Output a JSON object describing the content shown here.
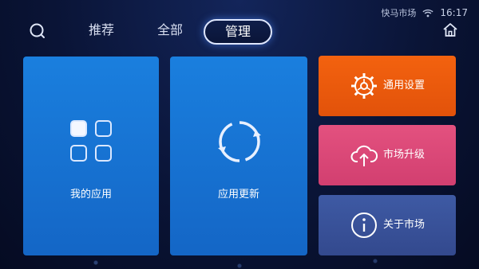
{
  "status_bar": {
    "app_name": "快马市场",
    "time": "16:17",
    "wifi_icon": "wifi-icon"
  },
  "top_nav": {
    "search_icon": "search-icon",
    "home_icon": "home-icon",
    "tabs": [
      {
        "label": "推荐",
        "selected": false
      },
      {
        "label": "全部",
        "selected": false
      },
      {
        "label": "管理",
        "selected": true
      }
    ]
  },
  "tiles": {
    "my_apps": {
      "label": "我的应用",
      "icon": "app-grid-icon",
      "color": "#1772d4"
    },
    "app_update": {
      "label": "应用更新",
      "icon": "refresh-icon",
      "color": "#1772d4"
    },
    "general_settings": {
      "label": "通用设置",
      "icon": "gear-icon",
      "color": "#ee5b0d"
    },
    "market_upgrade": {
      "label": "市场升级",
      "icon": "cloud-upload-icon",
      "color": "#dd4a78"
    },
    "about_market": {
      "label": "关于市场",
      "icon": "info-icon",
      "color": "#3a529a"
    }
  }
}
